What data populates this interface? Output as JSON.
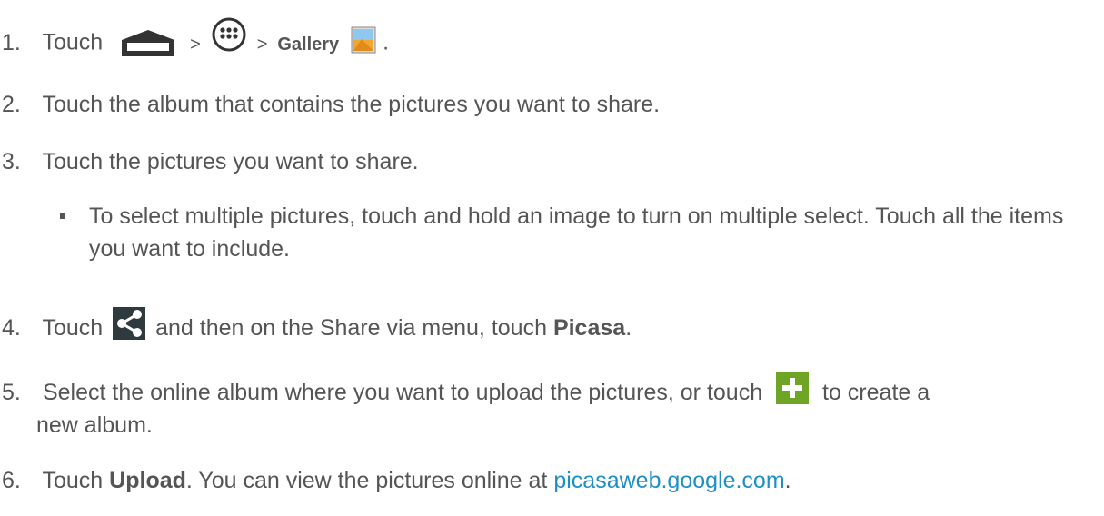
{
  "steps": [
    {
      "num": "1.",
      "touch": "Touch",
      "sep1": ">",
      "sep2": ">",
      "gallery": "Gallery",
      "end": "."
    },
    {
      "num": "2.",
      "text": "Touch the album that contains the pictures you want to share."
    },
    {
      "num": "3.",
      "text": "Touch the pictures you want to share.",
      "sub": "To select multiple pictures, touch and hold an image to turn on multiple select. Touch all the items you want to include."
    },
    {
      "num": "4.",
      "touch": "Touch",
      "mid": "and then on the Share via menu, touch",
      "picasa": "Picasa",
      "end": "."
    },
    {
      "num": "5.",
      "pre": "Select the online album where you want to upload the pictures, or touch",
      "post": "to create a",
      "line2": "new album."
    },
    {
      "num": "6.",
      "touch": "Touch",
      "upload": "Upload",
      "mid": ". You can view the pictures online at",
      "link": "picasaweb.google.com",
      "end": "."
    }
  ],
  "icons": {
    "home": "home-icon",
    "apps": "apps-icon",
    "gallery": "gallery-icon",
    "share": "share-icon",
    "add": "add-icon"
  },
  "colors": {
    "text": "#555555",
    "link": "#1e8fc4",
    "add_bg": "#6fa524"
  }
}
